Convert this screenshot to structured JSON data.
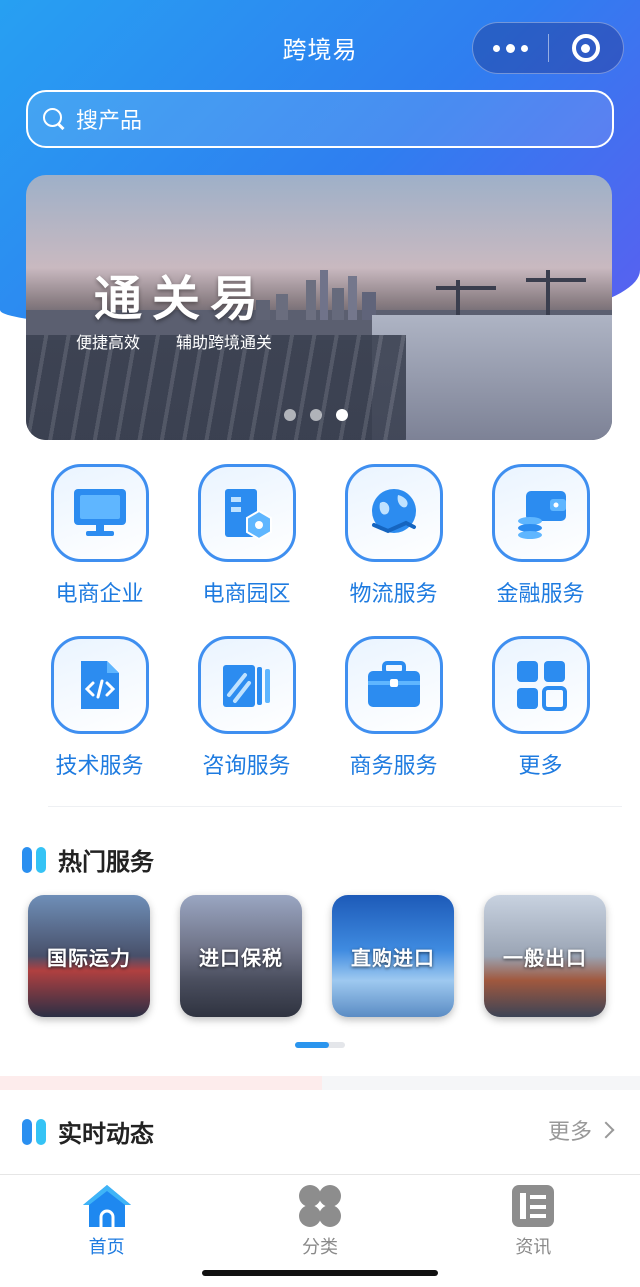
{
  "app": {
    "title": "跨境易"
  },
  "search": {
    "placeholder": "搜产品"
  },
  "banner": {
    "headline": "通关易",
    "subtitle_left": "便捷高效",
    "subtitle_right": "辅助跨境通关",
    "active_slide": 3,
    "slide_count": 3
  },
  "services": [
    {
      "label": "电商企业",
      "icon": "monitor-icon"
    },
    {
      "label": "电商园区",
      "icon": "park-building-icon"
    },
    {
      "label": "物流服务",
      "icon": "globe-logistics-icon"
    },
    {
      "label": "金融服务",
      "icon": "wallet-coins-icon"
    },
    {
      "label": "技术服务",
      "icon": "code-file-icon"
    },
    {
      "label": "咨询服务",
      "icon": "pages-icon"
    },
    {
      "label": "商务服务",
      "icon": "briefcase-icon"
    },
    {
      "label": "更多",
      "icon": "grid-more-icon"
    }
  ],
  "hot": {
    "title": "热门服务",
    "cards": [
      {
        "label": "国际运力"
      },
      {
        "label": "进口保税"
      },
      {
        "label": "直购进口"
      },
      {
        "label": "一般出口"
      }
    ]
  },
  "news": {
    "title": "实时动态",
    "more_label": "更多"
  },
  "tabbar": {
    "items": [
      {
        "label": "首页",
        "icon": "home-icon",
        "active": true
      },
      {
        "label": "分类",
        "icon": "category-icon",
        "active": false
      },
      {
        "label": "资讯",
        "icon": "news-icon",
        "active": false
      }
    ]
  },
  "colors": {
    "primary": "#1e7be0",
    "accent": "#35c3f5",
    "inactive": "#8a8a8a"
  }
}
